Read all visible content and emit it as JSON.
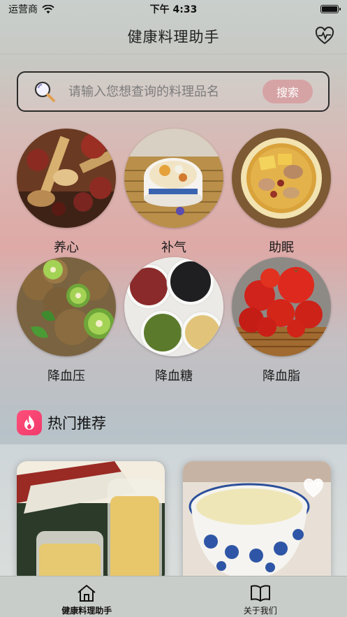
{
  "status": {
    "carrier": "运营商",
    "time": "下午 4:33"
  },
  "nav": {
    "title": "健康料理助手",
    "icon": "heart-pulse-icon"
  },
  "search": {
    "placeholder": "请输入您想查询的料理品名",
    "button_label": "搜索"
  },
  "categories": [
    {
      "label": "养心",
      "image": "herbal-ingredients"
    },
    {
      "label": "补气",
      "image": "tonic-soup-bowl"
    },
    {
      "label": "助眠",
      "image": "stew-bowl"
    },
    {
      "label": "降血压",
      "image": "kiwi-fruits"
    },
    {
      "label": "降血糖",
      "image": "assorted-beans"
    },
    {
      "label": "降血脂",
      "image": "tomatoes-basket"
    }
  ],
  "hot": {
    "title": "热门推荐",
    "icon": "fire-icon"
  },
  "recommendations": [
    {
      "image": "honey-jars"
    },
    {
      "image": "soy-milk-cup",
      "fav_icon": "heart-plus-icon"
    }
  ],
  "tabbar": {
    "items": [
      {
        "label": "健康料理助手",
        "icon": "home-icon",
        "active": true
      },
      {
        "label": "关于我们",
        "icon": "book-icon",
        "active": false
      }
    ]
  },
  "colors": {
    "accent": "#d6a3a5",
    "fire": "#f0396b"
  }
}
